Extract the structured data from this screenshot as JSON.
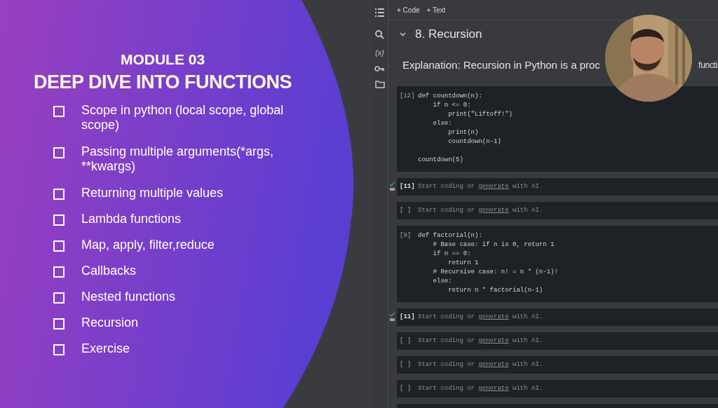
{
  "slide": {
    "module": "MODULE 03",
    "title": "DEEP DIVE INTO FUNCTIONS",
    "topics": [
      {
        "label": "Scope in python (local scope, global scope)",
        "checked": false
      },
      {
        "label": "Passing multiple arguments(*args, **kwargs)",
        "checked": false
      },
      {
        "label": "Returning multiple values",
        "checked": false
      },
      {
        "label": "Lambda functions",
        "checked": false
      },
      {
        "label": "Map, apply, filter,reduce",
        "checked": false
      },
      {
        "label": "Callbacks",
        "checked": false
      },
      {
        "label": "Nested functions",
        "checked": false
      },
      {
        "label": "Recursion",
        "checked": false
      },
      {
        "label": "Exercise",
        "checked": false
      }
    ]
  },
  "notebook": {
    "sidebar": {
      "variables_icon": "{x}"
    },
    "toolbar": [
      "+ Code",
      "+ Text"
    ],
    "section": {
      "title": "8. Recursion",
      "expanded": true
    },
    "explanation": {
      "text": "Explanation: Recursion in Python is a proc",
      "tail": "functi"
    },
    "cells": [
      {
        "kind": "code",
        "prompt": "[12]",
        "lines": [
          {
            "text": "def countdown(n):"
          },
          {
            "text": "    if n <= 0:"
          },
          {
            "text": "        print(\"Liftoff!\")"
          },
          {
            "text": "    else:"
          },
          {
            "text": "        print(n)"
          },
          {
            "text": "        countdown(n-1)"
          },
          {
            "gap_before": true,
            "text": "countdown(5)"
          }
        ]
      },
      {
        "kind": "empty",
        "prompt": "[11]",
        "executed": true,
        "before": "Start coding or",
        "link": "generate",
        "after": "with AI."
      },
      {
        "kind": "empty",
        "prompt": "[ ]",
        "executed": false,
        "before": "Start coding or",
        "link": "generate",
        "after": "with AI."
      },
      {
        "kind": "code",
        "prompt": "[9]",
        "lines": [
          {
            "text": "def factorial(n):"
          },
          {
            "text": "    # Base case: if n is 0, return 1"
          },
          {
            "text": "    if n == 0:"
          },
          {
            "text": "        return 1"
          },
          {
            "text": "    # Recursive case: n! = n * (n-1)!"
          },
          {
            "text": "    else:"
          },
          {
            "text": "        return n * factorial(n-1)"
          }
        ]
      },
      {
        "kind": "empty",
        "prompt": "[11]",
        "executed": true,
        "before": "Start coding or",
        "link": "generate",
        "after": "with AI."
      },
      {
        "kind": "empty",
        "prompt": "[ ]",
        "executed": false,
        "before": "Start coding or",
        "link": "generate",
        "after": "with AI."
      },
      {
        "kind": "empty",
        "prompt": "[ ]",
        "executed": false,
        "before": "Start coding or",
        "link": "generate",
        "after": "with AI."
      },
      {
        "kind": "empty",
        "prompt": "[ ]",
        "executed": false,
        "before": "Start coding or",
        "link": "generate",
        "after": "with AI."
      }
    ]
  }
}
